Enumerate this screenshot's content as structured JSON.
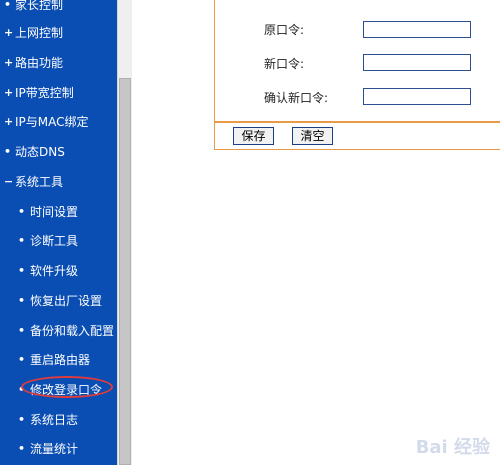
{
  "sidebar": {
    "items": [
      {
        "bullet": "•",
        "label": "家长控制",
        "level": "top"
      },
      {
        "bullet": "+",
        "label": "上网控制",
        "level": "top"
      },
      {
        "bullet": "+",
        "label": "路由功能",
        "level": "top"
      },
      {
        "bullet": "+",
        "label": "IP带宽控制",
        "level": "top"
      },
      {
        "bullet": "+",
        "label": "IP与MAC绑定",
        "level": "top"
      },
      {
        "bullet": "•",
        "label": "动态DNS",
        "level": "top"
      },
      {
        "bullet": "−",
        "label": "系统工具",
        "level": "top"
      },
      {
        "bullet": "•",
        "label": "时间设置",
        "level": "sub"
      },
      {
        "bullet": "•",
        "label": "诊断工具",
        "level": "sub"
      },
      {
        "bullet": "•",
        "label": "软件升级",
        "level": "sub"
      },
      {
        "bullet": "•",
        "label": "恢复出厂设置",
        "level": "sub"
      },
      {
        "bullet": "•",
        "label": "备份和载入配置",
        "level": "sub"
      },
      {
        "bullet": "•",
        "label": "重启路由器",
        "level": "sub"
      },
      {
        "bullet": "•",
        "label": "修改登录口令",
        "level": "sub",
        "selected": true
      },
      {
        "bullet": "•",
        "label": "系统日志",
        "level": "sub"
      },
      {
        "bullet": "•",
        "label": "流量统计",
        "level": "sub"
      }
    ]
  },
  "form": {
    "old_password_label": "原口令:",
    "new_password_label": "新口令:",
    "confirm_password_label": "确认新口令:",
    "old_password_value": "",
    "new_password_value": "",
    "confirm_password_value": ""
  },
  "buttons": {
    "save_label": "保存",
    "clear_label": "清空"
  },
  "watermark": "Bai 经验",
  "colors": {
    "sidebar_bg": "#0a4eb3",
    "panel_border": "#e89a49",
    "highlight_ring": "#e23b3b"
  }
}
